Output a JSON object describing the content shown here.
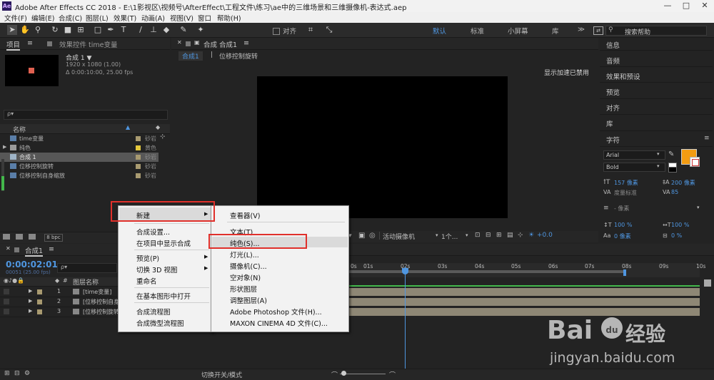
{
  "title_bar": {
    "logo": "Ae",
    "text": "Adobe After Effects CC 2018 - E:\\1影视区\\视频号\\AfterEffect\\工程文件\\练习\\ae中的三维场景和三维摄像机-表达式.aep",
    "minimize": "—",
    "maximize": "□",
    "close": "✕"
  },
  "menu_bar": [
    "文件(F)",
    "编辑(E)",
    "合成(C)",
    "图层(L)",
    "效果(T)",
    "动画(A)",
    "视图(V)",
    "窗口",
    "帮助(H)"
  ],
  "toolbar": {
    "align_label": "对齐",
    "workspaces": [
      "默认",
      "标准",
      "小屏幕",
      "库"
    ],
    "workspace_menu": "≫",
    "search_placeholder": "搜索帮助"
  },
  "project_panel": {
    "tab_project": "项目",
    "tab_effects": "效果控件 time变量",
    "comp_name": "合成 1 ▼",
    "comp_size": "1920 x 1080 (1.00)",
    "comp_duration": "Δ 0:00:10:00, 25.00 fps",
    "search_placeholder": "ρ▾",
    "col_name": "名称",
    "items": [
      {
        "name": "time变量",
        "type": "砂岩"
      },
      {
        "name": "纯色",
        "type": "黄色"
      },
      {
        "name": "合成 1",
        "type": "砂岩"
      },
      {
        "name": "位移控制旋转",
        "type": "砂岩"
      },
      {
        "name": "位移控制自身缩放",
        "type": "砂岩"
      }
    ],
    "bpc": "8 bpc"
  },
  "comp_panel": {
    "tab_label": "合成 合成1",
    "sub_tab_1": "合成1",
    "sub_tab_2": "位移控制旋转",
    "gpu_notice": "显示加速已禁用",
    "camera_dropdown": "活动摄像机",
    "view_dropdown": "1个...",
    "exposure": "+0.0"
  },
  "right_panel": {
    "items": [
      "信息",
      "音频",
      "效果和预设",
      "预览",
      "对齐",
      "库",
      "字符"
    ],
    "font": "Arial",
    "font_style": "Bold",
    "font_size": "157 像素",
    "leading": "200 像素",
    "kerning": "度量标准",
    "tracking": "85",
    "stroke_width": "- 像素",
    "stroke_type": "在描边上填充",
    "vert_scale": "100 %",
    "horiz_scale": "100 %",
    "baseline": "0 像素",
    "tsume": "0 %",
    "fill_color": "#f39c12"
  },
  "timeline": {
    "tab_label": "合成1",
    "timecode": "0:00:02:01",
    "timecode_sub": "00051 (25.00 fps)",
    "search_placeholder": "ρ▾",
    "col_layer_name": "图层名称",
    "layers": [
      {
        "num": "1",
        "name": "[time变量]"
      },
      {
        "num": "2",
        "name": "[位移控制自身"
      },
      {
        "num": "3",
        "name": "[位移控制旋转"
      }
    ],
    "ruler": [
      "0s",
      "01s",
      "02s",
      "03s",
      "04s",
      "05s",
      "06s",
      "07s",
      "08s",
      "09s",
      "10s"
    ],
    "toggle_label": "切换开关/模式"
  },
  "context_menu": {
    "items": [
      {
        "label": "新建",
        "has_sub": true
      },
      {
        "label": "合成设置..."
      },
      {
        "label": "在项目中显示合成"
      },
      {
        "label": "预览(P)",
        "has_sub": true
      },
      {
        "label": "切换 3D 视图",
        "has_sub": true
      },
      {
        "label": "重命名"
      },
      {
        "label": "在基本图形中打开"
      },
      {
        "label": "合成流程图"
      },
      {
        "label": "合成微型流程图"
      }
    ],
    "arrow": "▶"
  },
  "submenu": {
    "items": [
      "查看器(V)",
      "文本(T)",
      "纯色(S)...",
      "灯光(L)...",
      "摄像机(C)...",
      "空对象(N)",
      "形状图层",
      "调整图层(A)",
      "Adobe Photoshop 文件(H)...",
      "MAXON CINEMA 4D 文件(C)..."
    ]
  },
  "watermark": {
    "logo_text": "Bai",
    "paw": "du",
    "brand": "经验",
    "url": "jingyan.baidu.com"
  }
}
